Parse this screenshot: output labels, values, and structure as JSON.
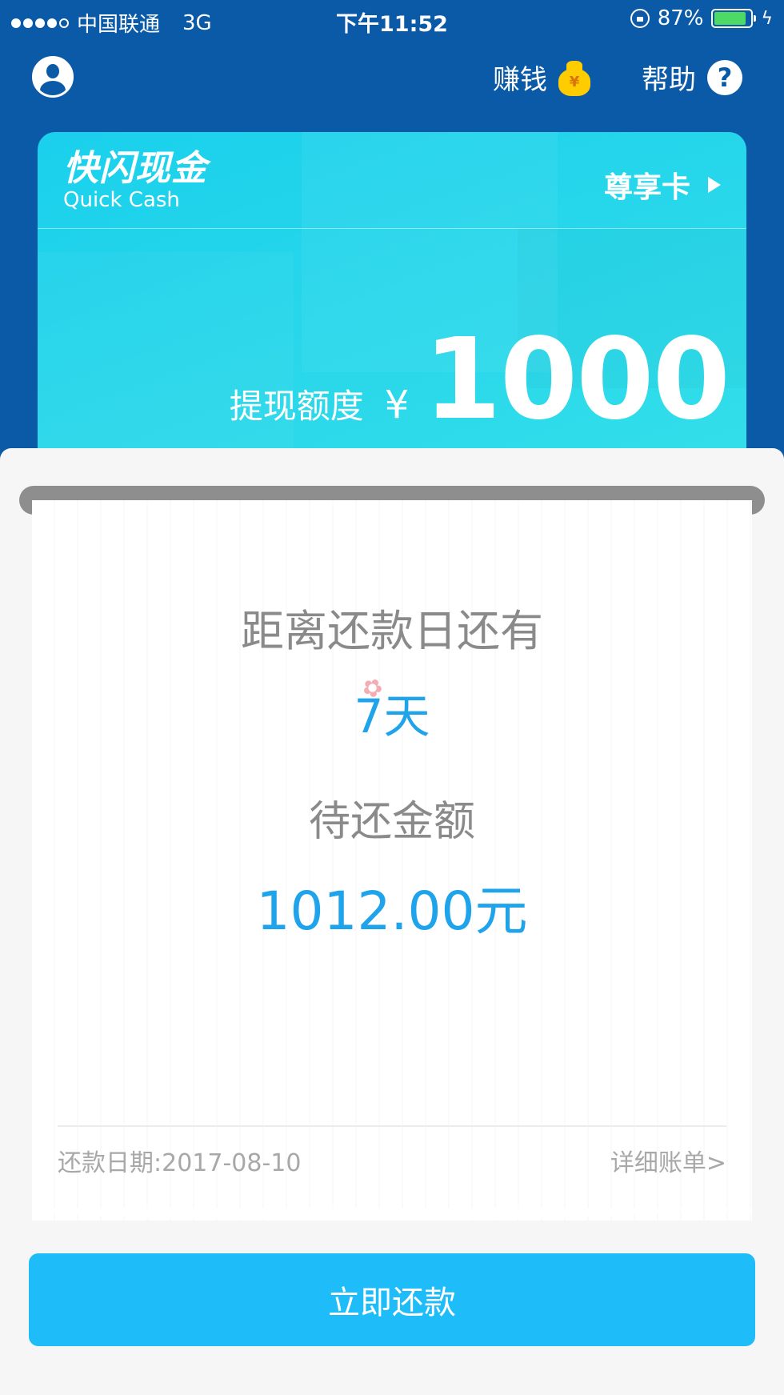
{
  "status_bar": {
    "carrier": "中国联通",
    "network": "3G",
    "time": "下午11:52",
    "battery_percent": "87%",
    "battery_level": 0.87
  },
  "nav": {
    "earn_label": "赚钱",
    "help_label": "帮助",
    "help_icon_glyph": "?",
    "moneybag_glyph": "¥"
  },
  "card": {
    "logo_cn": "快闪现金",
    "logo_en": "Quick Cash",
    "badge_label": "尊享卡",
    "credit_label": "提现额度",
    "currency": "¥",
    "credit_amount": "1000"
  },
  "receipt": {
    "days_label": "距离还款日还有",
    "days_value": "7天",
    "amount_label": "待还金额",
    "amount_value": "1012.00元",
    "due_date": "还款日期:2017-08-10",
    "detail_link": "详细账单>"
  },
  "actions": {
    "pay_now": "立即还款"
  },
  "colors": {
    "header_bg": "#0a5aa8",
    "card_accent": "#1ad0ec",
    "value_blue": "#1fa3ea",
    "button_blue": "#1ebcf8"
  }
}
